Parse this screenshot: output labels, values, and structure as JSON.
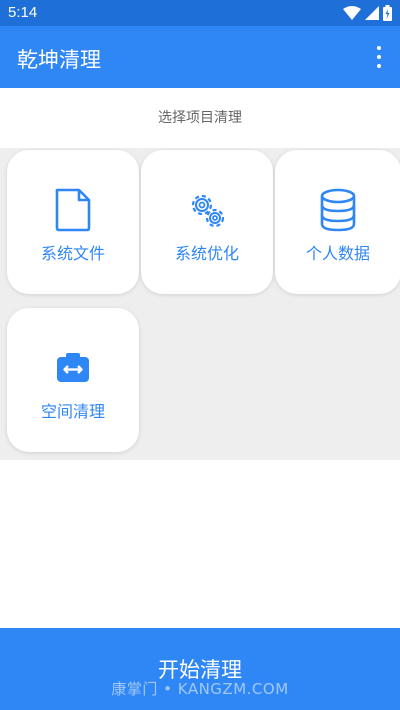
{
  "status_bar": {
    "time": "5:14"
  },
  "app_bar": {
    "title": "乾坤清理"
  },
  "content": {
    "subtitle": "选择项目清理",
    "cards": [
      {
        "label": "系统文件",
        "icon": "file-icon"
      },
      {
        "label": "系统优化",
        "icon": "gear-icon"
      },
      {
        "label": "个人数据",
        "icon": "database-icon"
      },
      {
        "label": "空间清理",
        "icon": "storage-icon"
      }
    ]
  },
  "bottom": {
    "button_label": "开始清理",
    "watermark": "康掌门 • KANGZM.COM"
  },
  "colors": {
    "accent": "#2f86f5",
    "status_bar": "#1f6fd8",
    "background": "#eeeeee"
  }
}
